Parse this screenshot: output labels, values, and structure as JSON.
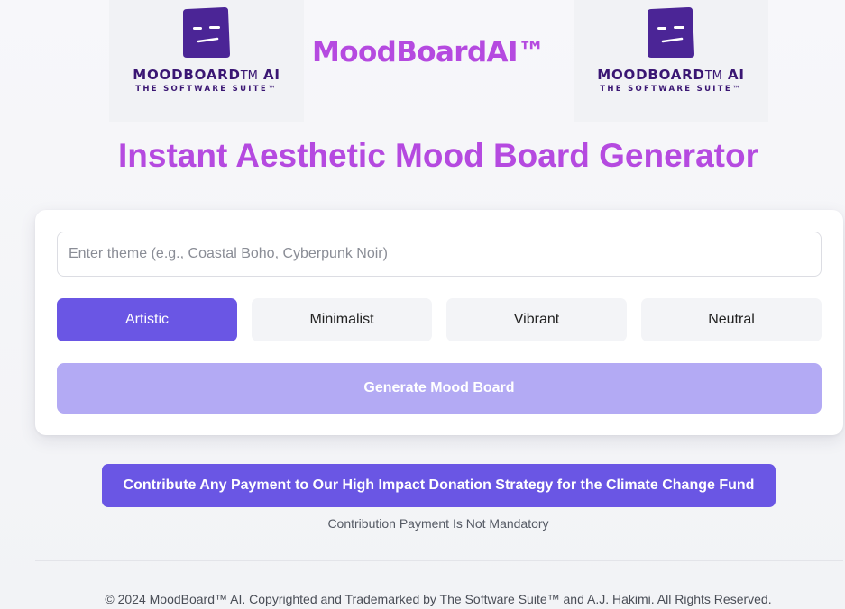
{
  "header": {
    "logo": {
      "name": "MOODBOARD",
      "name_tm": "TM",
      "name_suffix": "AI",
      "tagline": "THE SOFTWARE SUITE™",
      "icon": "moody-face-mascot-icon",
      "colors": {
        "mascot": "#4b2596",
        "text": "#3a1673"
      }
    },
    "brand": "MoodBoardAI™",
    "headline": "Instant Aesthetic Mood Board Generator"
  },
  "generator": {
    "theme_input": {
      "placeholder": "Enter theme (e.g., Coastal Boho, Cyberpunk Noir)",
      "value": ""
    },
    "styles": [
      {
        "label": "Artistic",
        "selected": true
      },
      {
        "label": "Minimalist",
        "selected": false
      },
      {
        "label": "Vibrant",
        "selected": false
      },
      {
        "label": "Neutral",
        "selected": false
      }
    ],
    "generate_label": "Generate Mood Board"
  },
  "donation": {
    "button_label": "Contribute Any Payment to Our High Impact Donation Strategy for the Climate Change Fund",
    "note": "Contribution Payment Is Not Mandatory"
  },
  "footer": {
    "text": "© 2024 MoodBoard™ AI. Copyrighted and Trademarked by The Software Suite™ and A.J. Hakimi. All Rights Reserved."
  },
  "colors": {
    "accent": "#6a56e4",
    "accent_disabled": "#b3aaf4",
    "brand_purple": "#b54ae0",
    "background": "#f4f5f8"
  }
}
